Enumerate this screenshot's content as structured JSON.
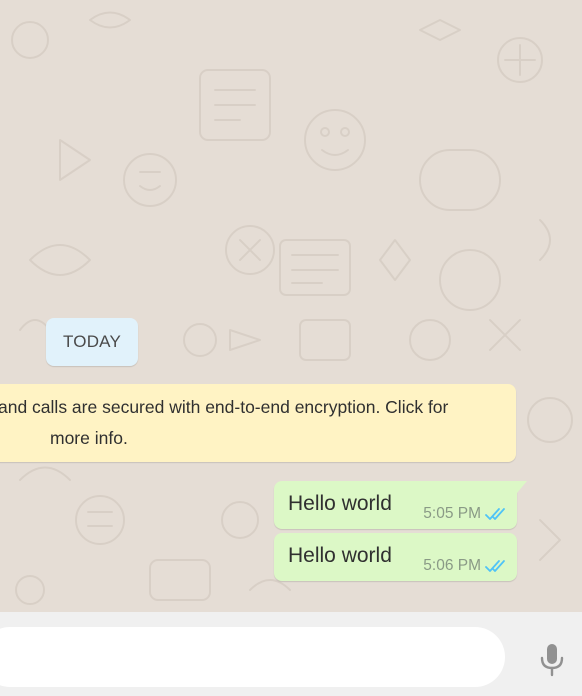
{
  "chat": {
    "day_badge": "TODAY",
    "system_notice": {
      "line1": "and calls are secured with end-to-end encryption. Click for",
      "line2": "more info."
    },
    "messages": [
      {
        "text": "Hello world",
        "time": "5:05 PM",
        "status": "read"
      },
      {
        "text": "Hello world",
        "time": "5:06 PM",
        "status": "read"
      }
    ]
  },
  "composer": {
    "input_value": "",
    "placeholder": "",
    "mic_icon": "microphone-icon"
  },
  "colors": {
    "chat_background": "#e5ddd5",
    "outgoing_bubble": "#dcf8c6",
    "system_notice": "#fff3c4",
    "day_badge": "#e1f2fb",
    "read_ticks": "#4fc3f7",
    "compose_bar": "#f0f0f0",
    "mic_icon": "#919191"
  }
}
